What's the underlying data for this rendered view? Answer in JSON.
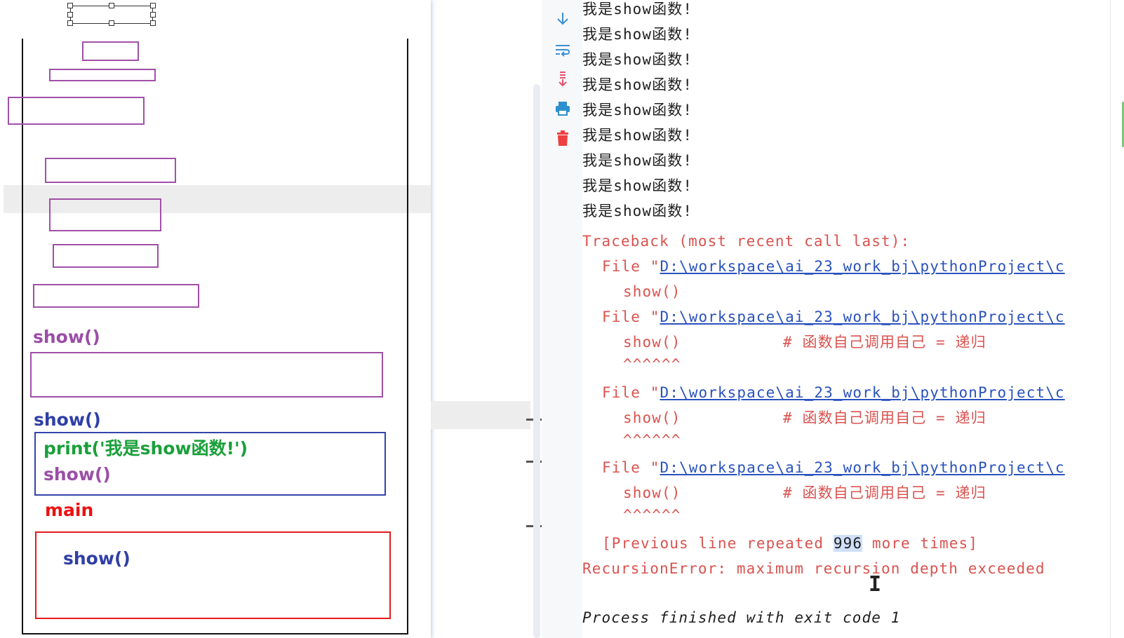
{
  "board": {
    "labels": {
      "show_upper": "show()",
      "show_lower": "show()",
      "print_stmt": "print('我是show函数!')",
      "show_inner": "show()",
      "main": "main",
      "show_main": "show()"
    }
  },
  "toolbar": {
    "icons": [
      "scroll-to-end-icon",
      "soft-wrap-icon",
      "scroll-down-icon",
      "print-icon",
      "trash-icon"
    ]
  },
  "console": {
    "stdout_lines": [
      "我是show函数!",
      "我是show函数!",
      "我是show函数!",
      "我是show函数!",
      "我是show函数!",
      "我是show函数!",
      "我是show函数!",
      "我是show函数!",
      "我是show函数!"
    ],
    "traceback_header": "Traceback (most recent call last):",
    "frames": [
      {
        "prefix": "File \"",
        "path": "D:\\workspace\\ai_23_work_bj\\pythonProject\\c",
        "code": "show()",
        "comment": "",
        "caret": ""
      },
      {
        "prefix": "File \"",
        "path": "D:\\workspace\\ai_23_work_bj\\pythonProject\\c",
        "code": "show()",
        "comment": "# 函数自己调用自己 = 递归",
        "caret": "^^^^^^"
      },
      {
        "prefix": "File \"",
        "path": "D:\\workspace\\ai_23_work_bj\\pythonProject\\c",
        "code": "show()",
        "comment": "# 函数自己调用自己 = 递归",
        "caret": "^^^^^^"
      },
      {
        "prefix": "File \"",
        "path": "D:\\workspace\\ai_23_work_bj\\pythonProject\\c",
        "code": "show()",
        "comment": "# 函数自己调用自己 = 递归",
        "caret": "^^^^^^"
      }
    ],
    "repeat": {
      "before": "[Previous line repeated ",
      "count": "996",
      "after": " more times]"
    },
    "error": "RecursionError: maximum recursion depth exceeded",
    "exit": "Process finished with exit code 1"
  },
  "colors": {
    "error": "#d9534f",
    "link": "#2a52be",
    "accent_purple": "#9a4ea6",
    "accent_blue": "#2f3fa6",
    "accent_green": "#1aa03a",
    "accent_red": "#ee1111"
  }
}
